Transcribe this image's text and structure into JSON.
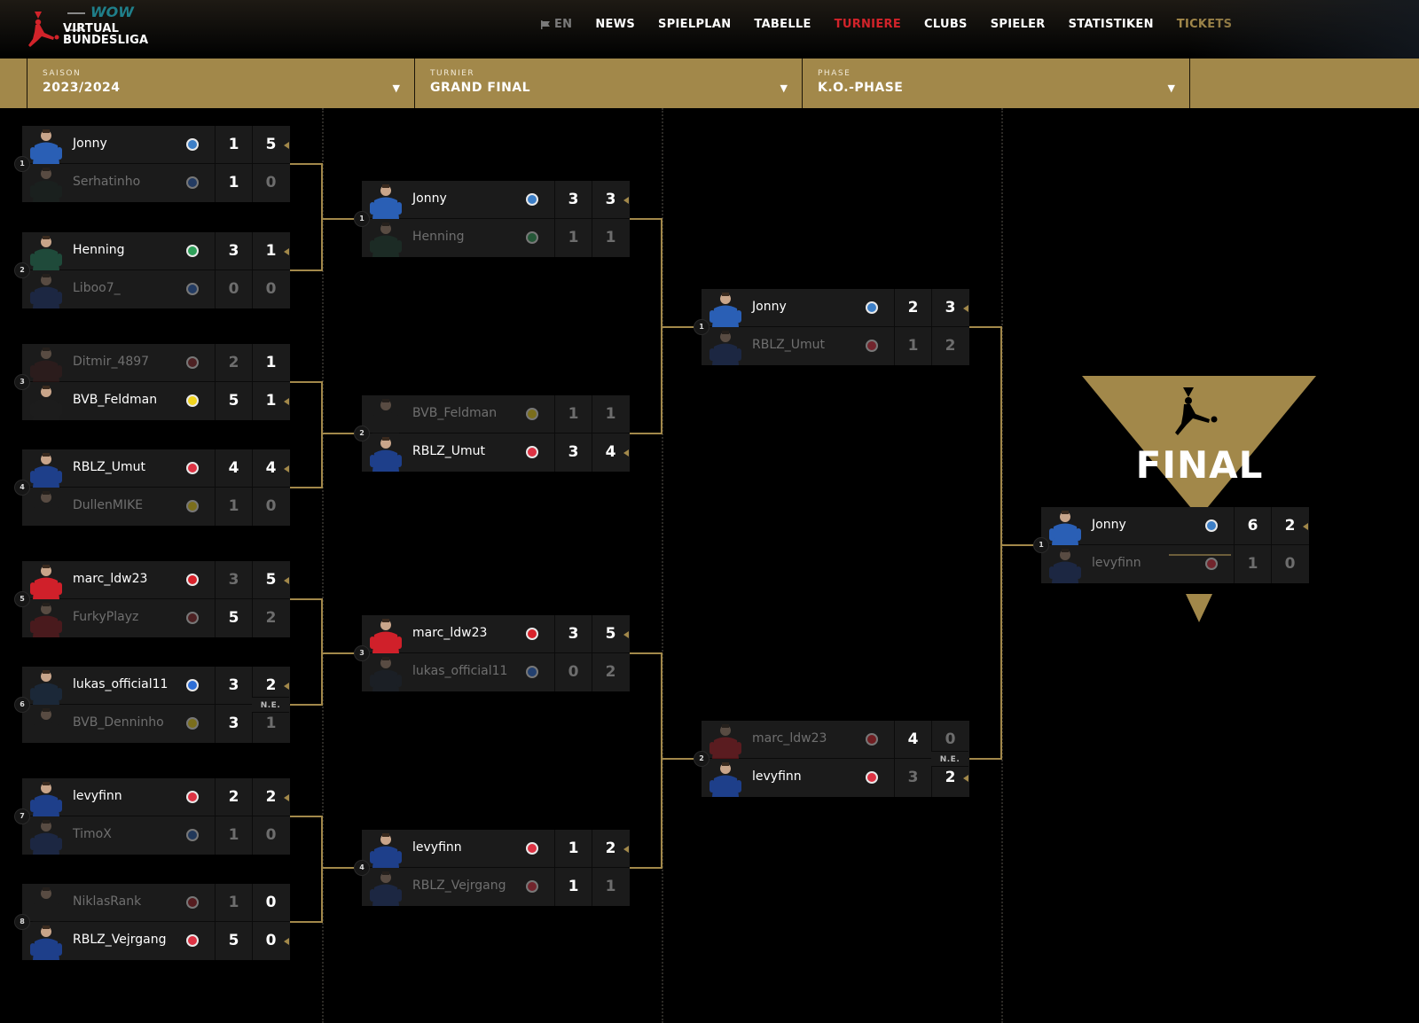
{
  "header": {
    "logo": {
      "wow": "WOW",
      "line1": "VIRTUAL",
      "line2": "BUNDESLIGA"
    },
    "nav": [
      {
        "label": "EN",
        "icon": "flag-icon",
        "kind": "lang"
      },
      {
        "label": "NEWS",
        "kind": "normal"
      },
      {
        "label": "SPIELPLAN",
        "kind": "normal"
      },
      {
        "label": "TABELLE",
        "kind": "normal"
      },
      {
        "label": "TURNIERE",
        "kind": "active"
      },
      {
        "label": "CLUBS",
        "kind": "normal"
      },
      {
        "label": "SPIELER",
        "kind": "normal"
      },
      {
        "label": "STATISTIKEN",
        "kind": "normal"
      },
      {
        "label": "TICKETS",
        "kind": "tickets"
      }
    ],
    "colors": {
      "accent_gold": "#a2884a",
      "active_red": "#d2232a"
    }
  },
  "filters": [
    {
      "label": "SAISON",
      "value": "2023/2024",
      "icon": "chevron-down-icon"
    },
    {
      "label": "TURNIER",
      "value": "GRAND FINAL",
      "icon": "chevron-down-icon"
    },
    {
      "label": "PHASE",
      "value": "K.O.-PHASE",
      "icon": "chevron-down-icon"
    }
  ],
  "final_banner": {
    "title": "FINAL",
    "icon": "bundesliga-player-icon"
  },
  "rounds": [
    {
      "name": "round-of-16",
      "matches": [
        {
          "seed": "1",
          "ne": null,
          "winner": 0,
          "players": [
            {
              "name": "Jonny",
              "club": "paderborn",
              "scores": [
                1,
                5
              ],
              "hi": [
                true,
                true
              ],
              "kit": "#2a5fb5"
            },
            {
              "name": "Serhatinho",
              "club": "hoffenheim",
              "scores": [
                1,
                0
              ],
              "hi": [
                true,
                false
              ],
              "kit": "#1a2b25"
            }
          ]
        },
        {
          "seed": "2",
          "ne": null,
          "winner": 0,
          "players": [
            {
              "name": "Henning",
              "club": "werder-bremen",
              "scores": [
                3,
                1
              ],
              "hi": [
                true,
                true
              ],
              "kit": "#1f4a3a"
            },
            {
              "name": "Liboo7_",
              "club": "hoffenheim",
              "scores": [
                0,
                0
              ],
              "hi": [
                false,
                false
              ],
              "kit": "#1e3f8a"
            }
          ]
        },
        {
          "seed": "3",
          "ne": null,
          "winner": 1,
          "players": [
            {
              "name": "Ditmir_4897",
              "club": "st-pauli",
              "scores": [
                2,
                1
              ],
              "hi": [
                false,
                true
              ],
              "kit": "#4a1f1f"
            },
            {
              "name": "BVB_Feldman",
              "club": "dortmund",
              "scores": [
                5,
                1
              ],
              "hi": [
                true,
                true
              ],
              "kit": "#1c1c1c"
            }
          ]
        },
        {
          "seed": "4",
          "ne": null,
          "winner": 0,
          "players": [
            {
              "name": "RBLZ_Umut",
              "club": "rb-leipzig",
              "scores": [
                4,
                4
              ],
              "hi": [
                true,
                true
              ],
              "kit": "#1e3f8a"
            },
            {
              "name": "DullenMIKE",
              "club": "dortmund",
              "scores": [
                1,
                0
              ],
              "hi": [
                false,
                false
              ],
              "kit": "#1c1c1c"
            }
          ]
        },
        {
          "seed": "5",
          "ne": null,
          "winner": 0,
          "players": [
            {
              "name": "marc_ldw23",
              "club": "leverkusen",
              "scores": [
                3,
                5
              ],
              "hi": [
                false,
                true
              ],
              "kit": "#d0202a"
            },
            {
              "name": "FurkyPlayz",
              "club": "st-pauli",
              "scores": [
                5,
                2
              ],
              "hi": [
                true,
                false
              ],
              "kit": "#a01a22"
            }
          ]
        },
        {
          "seed": "6",
          "ne": "N.E.",
          "winner": 0,
          "players": [
            {
              "name": "lukas_official11",
              "club": "hansa-rostock",
              "scores": [
                3,
                2
              ],
              "hi": [
                true,
                true
              ],
              "kit": "#1b2838"
            },
            {
              "name": "BVB_Denninho",
              "club": "dortmund",
              "scores": [
                3,
                1
              ],
              "hi": [
                true,
                false
              ],
              "kit": "#1c1c1c"
            }
          ]
        },
        {
          "seed": "7",
          "ne": null,
          "winner": 0,
          "players": [
            {
              "name": "levyfinn",
              "club": "rb-leipzig",
              "scores": [
                2,
                2
              ],
              "hi": [
                true,
                true
              ],
              "kit": "#1e3f8a"
            },
            {
              "name": "TimoX",
              "club": "bochum",
              "scores": [
                1,
                0
              ],
              "hi": [
                false,
                false
              ],
              "kit": "#1e3f8a"
            }
          ]
        },
        {
          "seed": "8",
          "ne": null,
          "winner": 1,
          "players": [
            {
              "name": "NiklasRank",
              "club": "nuernberg",
              "scores": [
                1,
                0
              ],
              "hi": [
                false,
                true
              ],
              "kit": "#1c1c1c"
            },
            {
              "name": "RBLZ_Vejrgang",
              "club": "rb-leipzig",
              "scores": [
                5,
                0
              ],
              "hi": [
                true,
                true
              ],
              "kit": "#1e3f8a"
            }
          ]
        }
      ]
    },
    {
      "name": "quarter-finals",
      "matches": [
        {
          "seed": "1",
          "ne": null,
          "winner": 0,
          "players": [
            {
              "name": "Jonny",
              "club": "paderborn",
              "scores": [
                3,
                3
              ],
              "hi": [
                true,
                true
              ],
              "kit": "#2a5fb5"
            },
            {
              "name": "Henning",
              "club": "werder-bremen",
              "scores": [
                1,
                1
              ],
              "hi": [
                false,
                false
              ],
              "kit": "#1f4a3a"
            }
          ]
        },
        {
          "seed": "2",
          "ne": null,
          "winner": 1,
          "players": [
            {
              "name": "BVB_Feldman",
              "club": "dortmund",
              "scores": [
                1,
                1
              ],
              "hi": [
                false,
                false
              ],
              "kit": "#1c1c1c"
            },
            {
              "name": "RBLZ_Umut",
              "club": "rb-leipzig",
              "scores": [
                3,
                4
              ],
              "hi": [
                true,
                true
              ],
              "kit": "#1e3f8a"
            }
          ]
        },
        {
          "seed": "3",
          "ne": null,
          "winner": 0,
          "players": [
            {
              "name": "marc_ldw23",
              "club": "leverkusen",
              "scores": [
                3,
                5
              ],
              "hi": [
                true,
                true
              ],
              "kit": "#d0202a"
            },
            {
              "name": "lukas_official11",
              "club": "hansa-rostock",
              "scores": [
                0,
                2
              ],
              "hi": [
                false,
                false
              ],
              "kit": "#1b2838"
            }
          ]
        },
        {
          "seed": "4",
          "ne": null,
          "winner": 0,
          "players": [
            {
              "name": "levyfinn",
              "club": "rb-leipzig",
              "scores": [
                1,
                2
              ],
              "hi": [
                true,
                true
              ],
              "kit": "#1e3f8a"
            },
            {
              "name": "RBLZ_Vejrgang",
              "club": "rb-leipzig",
              "scores": [
                1,
                1
              ],
              "hi": [
                true,
                false
              ],
              "kit": "#1e3f8a"
            }
          ]
        }
      ]
    },
    {
      "name": "semi-finals",
      "matches": [
        {
          "seed": "1",
          "ne": null,
          "winner": 0,
          "players": [
            {
              "name": "Jonny",
              "club": "paderborn",
              "scores": [
                2,
                3
              ],
              "hi": [
                true,
                true
              ],
              "kit": "#2a5fb5"
            },
            {
              "name": "RBLZ_Umut",
              "club": "rb-leipzig",
              "scores": [
                1,
                2
              ],
              "hi": [
                false,
                false
              ],
              "kit": "#1e3f8a"
            }
          ]
        },
        {
          "seed": "2",
          "ne": "N.E.",
          "winner": 1,
          "players": [
            {
              "name": "marc_ldw23",
              "club": "leverkusen",
              "scores": [
                4,
                0
              ],
              "hi": [
                true,
                false
              ],
              "kit": "#d0202a"
            },
            {
              "name": "levyfinn",
              "club": "rb-leipzig",
              "scores": [
                3,
                2
              ],
              "hi": [
                false,
                true
              ],
              "kit": "#1e3f8a"
            }
          ]
        }
      ]
    },
    {
      "name": "final",
      "matches": [
        {
          "seed": "1",
          "ne": null,
          "winner": 0,
          "players": [
            {
              "name": "Jonny",
              "club": "paderborn",
              "scores": [
                6,
                2
              ],
              "hi": [
                true,
                true
              ],
              "kit": "#2a5fb5"
            },
            {
              "name": "levyfinn",
              "club": "rb-leipzig",
              "scores": [
                1,
                0
              ],
              "hi": [
                false,
                false
              ],
              "kit": "#1e3f8a"
            }
          ]
        }
      ]
    }
  ],
  "club_colors": {
    "paderborn": "#3d7fc7",
    "hoffenheim": "#2e62b8",
    "werder-bremen": "#2fa05a",
    "st-pauli": "#8a2a2e",
    "dortmund": "#f1d41e",
    "rb-leipzig": "#dd3344",
    "leverkusen": "#d8222b",
    "hansa-rostock": "#2d6ed6",
    "bochum": "#2a5ca8",
    "nuernberg": "#9c1f24"
  }
}
